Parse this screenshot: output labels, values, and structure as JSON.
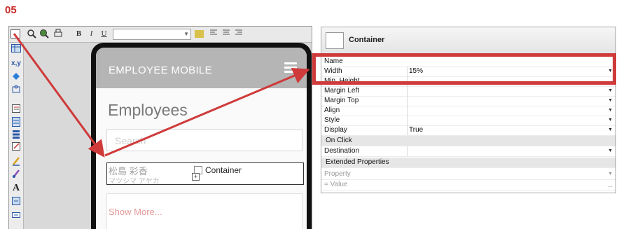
{
  "step_label": "05",
  "toolbar": {
    "items": [
      "zoom-in-icon",
      "zoom-out-icon",
      "print-icon"
    ],
    "bold": "B",
    "italic": "I",
    "underline": "U",
    "style_select_value": ""
  },
  "palette": {
    "items": [
      "container-icon",
      "table-icon",
      "coordinates-icon",
      "diamond-icon",
      "puzzle-icon",
      "list-icon",
      "form-icon",
      "stack-icon",
      "edit-icon",
      "pencil-icon",
      "brush-icon",
      "text-icon",
      "label-icon",
      "input-icon"
    ],
    "xy_label": "x,y",
    "text_label": "A"
  },
  "mobile": {
    "app_title": "EMPLOYEE MOBILE",
    "page_title": "Employees",
    "search_placeholder": "Search",
    "list_item": {
      "name": "松島 彩香",
      "kana": "マツシマ アヤカ",
      "container_label": "Container"
    },
    "show_more": "Show More..."
  },
  "properties": {
    "header_title": "Container",
    "rows": [
      {
        "key": "Name",
        "value": ""
      },
      {
        "key": "Width",
        "value": "15%",
        "dropdown": true
      },
      {
        "key": "Min. Height",
        "value": ""
      },
      {
        "key": "Margin Left",
        "value": "",
        "dropdown": true
      },
      {
        "key": "Margin Top",
        "value": "",
        "dropdown": true
      },
      {
        "key": "Align",
        "value": "",
        "dropdown": true
      },
      {
        "key": "Style",
        "value": "",
        "dropdown": true
      },
      {
        "key": "Display",
        "value": "True",
        "dropdown": true
      }
    ],
    "section_on_click": "On Click",
    "destination": {
      "key": "Destination",
      "value": ""
    },
    "section_extended": "Extended Properties",
    "extended_rows": [
      {
        "key": "Property",
        "value": ""
      },
      {
        "key": "= Value",
        "value": ""
      }
    ],
    "ellipsis": "...",
    "dropdown_glyph": "▼"
  },
  "colors": {
    "accent_red": "#cf3a3a",
    "appbar": "#b5b5b5"
  }
}
